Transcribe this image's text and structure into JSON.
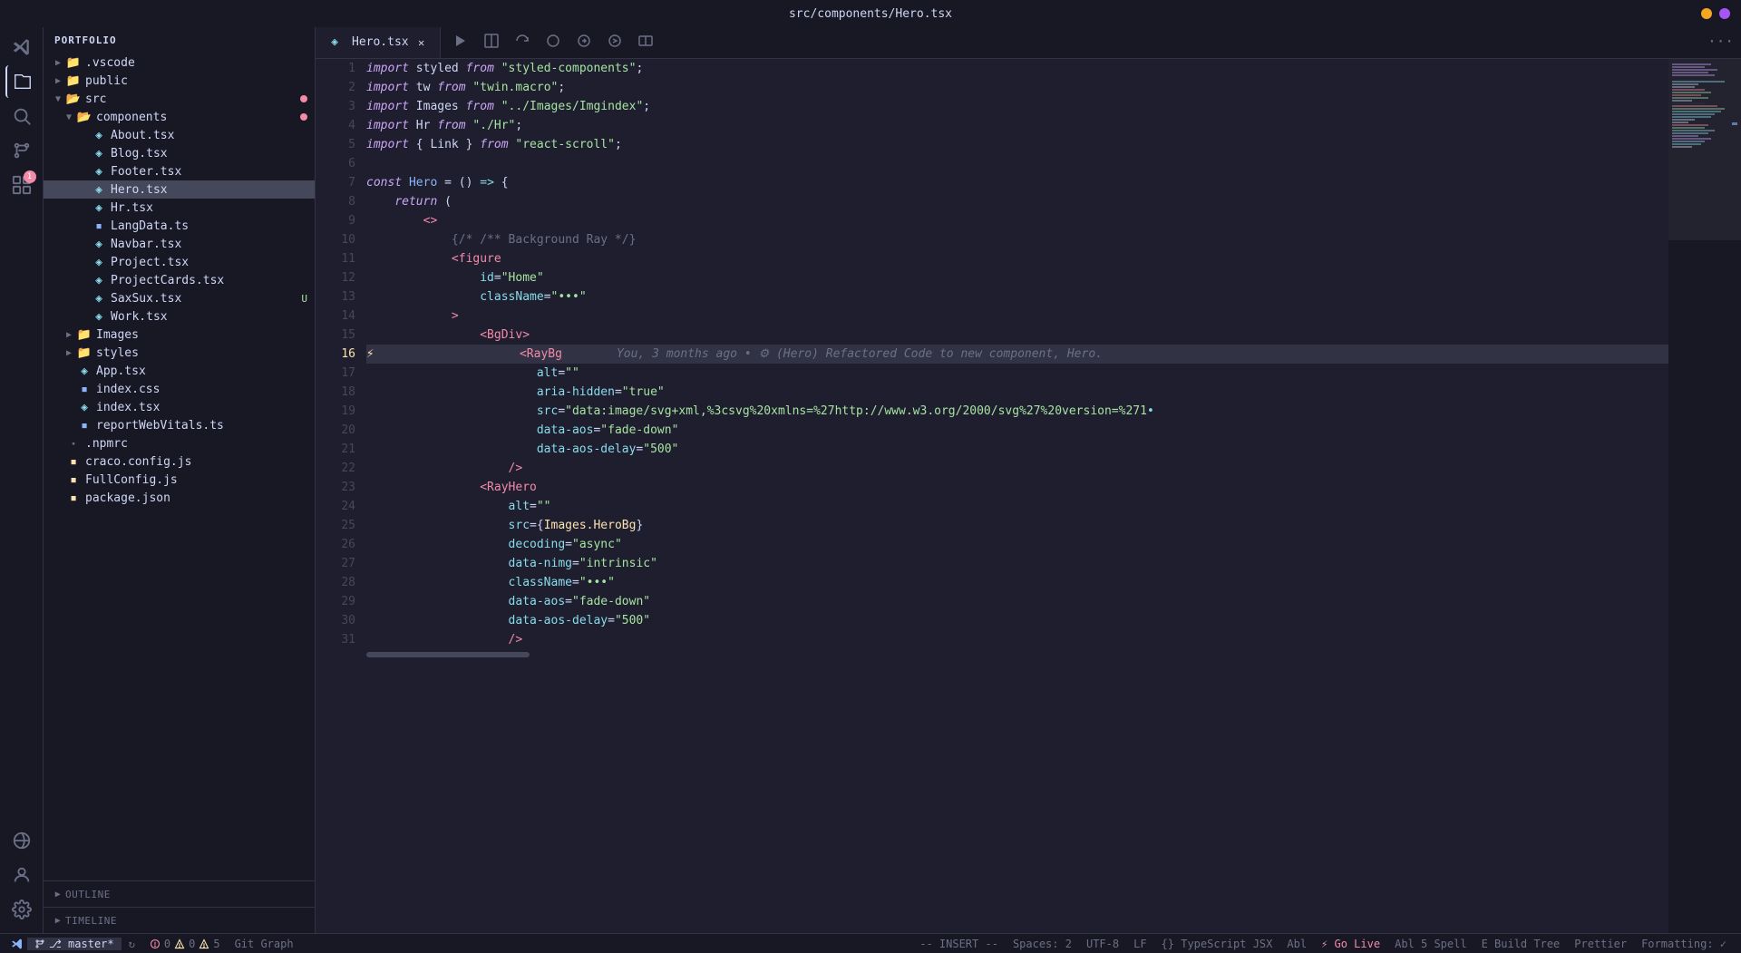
{
  "titleBar": {
    "title": "src/components/Hero.tsx",
    "controls": {
      "yellow": "#f5a623",
      "purple": "#a855f7"
    }
  },
  "tabs": [
    {
      "id": "hero",
      "label": "Hero.tsx",
      "active": true,
      "modified": false
    }
  ],
  "toolbar": {
    "moreLabel": "···"
  },
  "sidebar": {
    "header": "PORTFOLIO",
    "tree": [
      {
        "id": "vscode",
        "indent": 1,
        "type": "folder",
        "arrow": "▶",
        "label": ".vscode"
      },
      {
        "id": "public",
        "indent": 1,
        "type": "folder",
        "arrow": "▶",
        "label": "public"
      },
      {
        "id": "src",
        "indent": 1,
        "type": "folder",
        "arrow": "▼",
        "label": "src",
        "dot": "red"
      },
      {
        "id": "components",
        "indent": 2,
        "type": "folder",
        "arrow": "▼",
        "label": "components",
        "dot": "red"
      },
      {
        "id": "About.tsx",
        "indent": 3,
        "type": "tsx",
        "label": "About.tsx"
      },
      {
        "id": "Blog.tsx",
        "indent": 3,
        "type": "tsx",
        "label": "Blog.tsx"
      },
      {
        "id": "Footer.tsx",
        "indent": 3,
        "type": "tsx",
        "label": "Footer.tsx"
      },
      {
        "id": "Hero.tsx",
        "indent": 3,
        "type": "tsx",
        "label": "Hero.tsx",
        "active": true
      },
      {
        "id": "Hr.tsx",
        "indent": 3,
        "type": "tsx",
        "label": "Hr.tsx"
      },
      {
        "id": "LangData.ts",
        "indent": 3,
        "type": "ts",
        "label": "LangData.ts"
      },
      {
        "id": "Navbar.tsx",
        "indent": 3,
        "type": "tsx",
        "label": "Navbar.tsx"
      },
      {
        "id": "Project.tsx",
        "indent": 3,
        "type": "tsx",
        "label": "Project.tsx"
      },
      {
        "id": "ProjectCards.tsx",
        "indent": 3,
        "type": "tsx",
        "label": "ProjectCards.tsx"
      },
      {
        "id": "SaxSux.tsx",
        "indent": 3,
        "type": "tsx",
        "label": "SaxSux.tsx",
        "badge": "U"
      },
      {
        "id": "Work.tsx",
        "indent": 3,
        "type": "tsx",
        "label": "Work.tsx"
      },
      {
        "id": "Images",
        "indent": 2,
        "type": "folder",
        "arrow": "▶",
        "label": "Images"
      },
      {
        "id": "styles",
        "indent": 2,
        "type": "folder",
        "arrow": "▶",
        "label": "styles"
      },
      {
        "id": "App.tsx",
        "indent": 2,
        "type": "tsx",
        "label": "App.tsx"
      },
      {
        "id": "index.css",
        "indent": 2,
        "type": "css",
        "label": "index.css"
      },
      {
        "id": "index.tsx",
        "indent": 2,
        "type": "tsx",
        "label": "index.tsx"
      },
      {
        "id": "reportWebVitals.ts",
        "indent": 2,
        "type": "ts",
        "label": "reportWebVitals.ts"
      },
      {
        "id": ".npmrc",
        "indent": 1,
        "type": "file",
        "label": ".npmrc"
      },
      {
        "id": "craco.config.js",
        "indent": 1,
        "type": "js",
        "label": "craco.config.js"
      },
      {
        "id": "FullConfig.js",
        "indent": 1,
        "type": "js",
        "label": "FullConfig.js"
      },
      {
        "id": "package.json",
        "indent": 1,
        "type": "json",
        "label": "package.json"
      }
    ],
    "outline": "OUTLINE",
    "timeline": "TIMELINE"
  },
  "code": {
    "lines": [
      {
        "num": 1,
        "content": "import_styled"
      },
      {
        "num": 2,
        "content": "import_tw"
      },
      {
        "num": 3,
        "content": "import_Images"
      },
      {
        "num": 4,
        "content": "import_Hr"
      },
      {
        "num": 5,
        "content": "import_Link"
      },
      {
        "num": 6,
        "content": ""
      },
      {
        "num": 7,
        "content": "const_Hero"
      },
      {
        "num": 8,
        "content": "return"
      },
      {
        "num": 9,
        "content": "fragment"
      },
      {
        "num": 10,
        "content": "comment"
      },
      {
        "num": 11,
        "content": "figure_open"
      },
      {
        "num": 12,
        "content": "id_attr"
      },
      {
        "num": 13,
        "content": "classname_attr"
      },
      {
        "num": 14,
        "content": "close_bracket"
      },
      {
        "num": 15,
        "content": "bgdiv_open"
      },
      {
        "num": 16,
        "content": "raybg_open"
      },
      {
        "num": 17,
        "content": "alt_attr"
      },
      {
        "num": 18,
        "content": "aria_attr"
      },
      {
        "num": 19,
        "content": "src_attr"
      },
      {
        "num": 20,
        "content": "aos_attr"
      },
      {
        "num": 21,
        "content": "aos_delay_attr"
      },
      {
        "num": 22,
        "content": "self_close"
      },
      {
        "num": 23,
        "content": "rayhero_open"
      },
      {
        "num": 24,
        "content": "alt_empty"
      },
      {
        "num": 25,
        "content": "src_images"
      },
      {
        "num": 26,
        "content": "decoding_attr"
      },
      {
        "num": 27,
        "content": "data_nimg"
      },
      {
        "num": 28,
        "content": "classname2"
      },
      {
        "num": 29,
        "content": "data_aos2"
      },
      {
        "num": 30,
        "content": "data_aos_delay2"
      },
      {
        "num": 31,
        "content": "self_close2"
      }
    ],
    "blameAnnotation": "You, 3 months ago • ⚙ (Hero) Refactored Code to new component, Hero."
  },
  "statusBar": {
    "git": "⎇ master*",
    "sync": "↻",
    "errors": "⚠ 0  ⚠ 0  ⚠ 5",
    "gitGraph": "Git Graph",
    "mode": "-- INSERT --",
    "spaces": "Spaces: 2",
    "encoding": "UTF-8",
    "lineEnding": "LF",
    "language": "{} TypeScript JSX",
    "abl": "Abl",
    "goLive": "⚡ Go Live",
    "spell": "Abl 5 Spell",
    "buildTree": "E Build Tree",
    "prettier": "Prettier",
    "formatting": "Formatting: ✓"
  }
}
